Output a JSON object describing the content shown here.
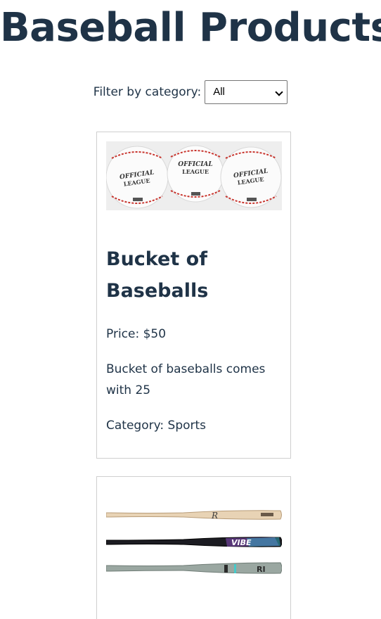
{
  "page": {
    "title": "Baseball Products"
  },
  "filter": {
    "label": "Filter by category:",
    "selected": "All"
  },
  "products": [
    {
      "name": "Bucket of Baseballs",
      "price": "Price: $50",
      "description": "Bucket of baseballs comes with 25",
      "category": "Category: Sports",
      "image_icon": "baseballs-image"
    },
    {
      "image_icon": "baseball-bats-image"
    }
  ],
  "colors": {
    "heading": "#1f3347",
    "card_border": "#cfcfcf",
    "stitching": "#c8352e"
  }
}
